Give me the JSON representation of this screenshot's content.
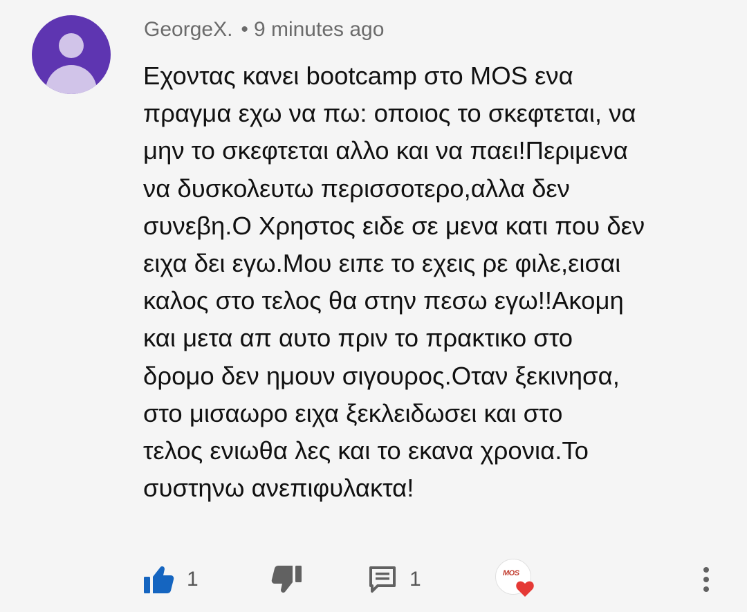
{
  "comment": {
    "author": "GeorgeX.",
    "separator": "•",
    "time": "9 minutes ago",
    "lines": [
      "Εχοντας κανει bootcamp στο MOS ενα",
      "πραγμα εχω να πω: οποιος το σκεφτεται, να",
      "μην το σκεφτεται αλλο και να παει!Περιμενα",
      "να δυσκολευτω περισσοτερο,αλλα δεν",
      "συνεβη.Ο Χρηστος ειδε σε μενα κατι που δεν",
      "ειχα δει εγω.Μου ειπε το εχεις ρε φιλε,εισαι",
      "καλος στο τελος θα στην πεσω εγω!!Ακομη",
      "και μετα απ αυτο πριν το πρακτικο στο",
      "δρομο δεν ημουν σιγουρος.Οταν ξεκινησα,",
      "στο μισαωρο ειχα ξεκλειδωσει και στο",
      "τελος ενιωθα λες και το εκανα χρονια.Το",
      "συστηνω ανεπιφυλακτα!"
    ]
  },
  "actions": {
    "like_count": "1",
    "reply_count": "1",
    "like_icon": "thumbs-up-icon",
    "dislike_icon": "thumbs-down-icon",
    "reply_icon": "comment-icon",
    "heart_icon": "creator-heart-icon",
    "more_icon": "more-vert-icon",
    "creator_logo_text": "MOS"
  },
  "colors": {
    "avatar_bg": "#5e35b1",
    "avatar_fg": "#d1c4e9",
    "like_active": "#1565c0",
    "icon_gray": "#616161",
    "heart": "#e53935",
    "background": "#f5f5f5"
  }
}
